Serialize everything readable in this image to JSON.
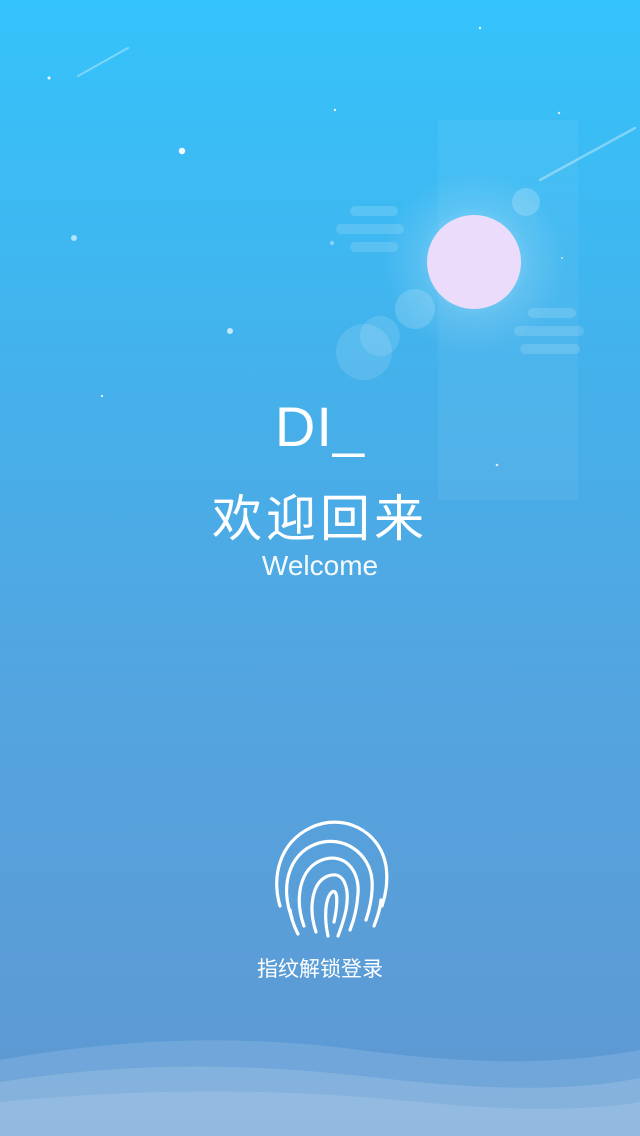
{
  "login": {
    "username": "DI_",
    "welcome_cn": "欢迎回来",
    "welcome_en": "Welcome",
    "fingerprint_label": "指纹解锁登录",
    "fingerprint_icon": "fingerprint-icon"
  },
  "theme": {
    "sky_top": "#35c3fb",
    "sky_bottom": "#5f98d2",
    "moon": "#ecdcfb",
    "text": "#ffffff"
  }
}
